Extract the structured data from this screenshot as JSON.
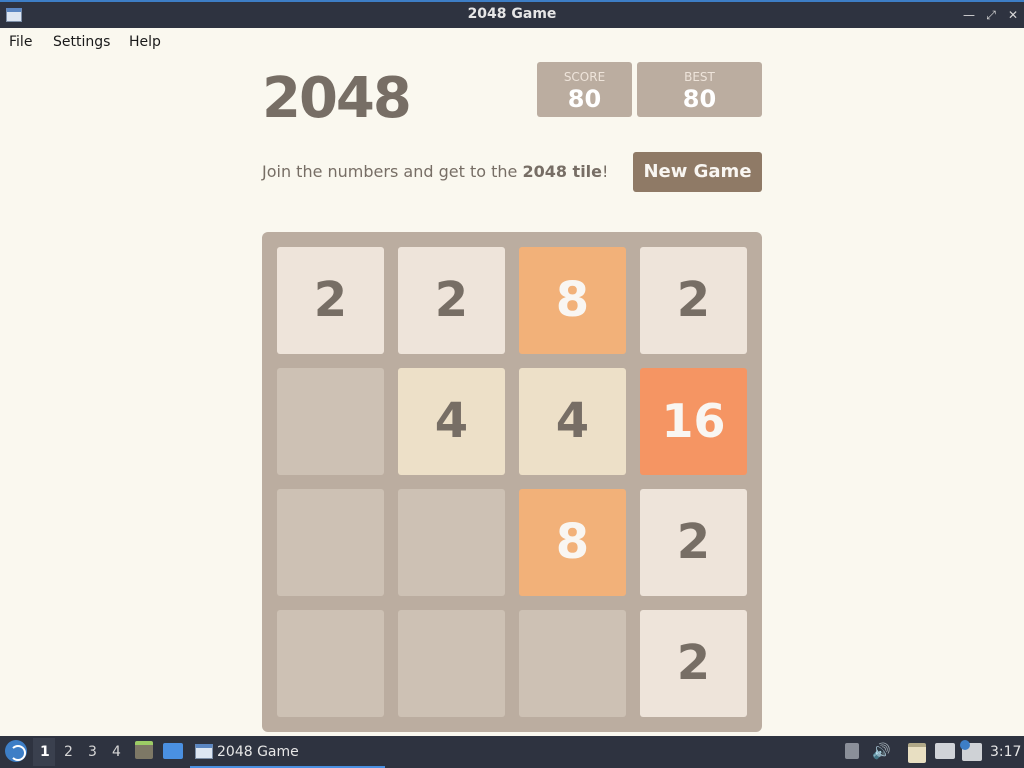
{
  "window": {
    "title": "2048 Game"
  },
  "menu": [
    "File",
    "Settings",
    "Help"
  ],
  "game": {
    "title": "2048",
    "score_label": "SCORE",
    "score": "80",
    "best_label": "BEST",
    "best": "80",
    "intro_prefix": "Join the numbers and get to the ",
    "intro_goal": "2048 tile",
    "intro_suffix": "!",
    "new_game_label": "New Game",
    "board": [
      [
        "2",
        "2",
        "8",
        "2"
      ],
      [
        "",
        "4",
        "4",
        "16"
      ],
      [
        "",
        "",
        "8",
        "2"
      ],
      [
        "",
        "",
        "",
        "2"
      ]
    ],
    "colors": {
      "background": "#faf8ef",
      "board": "#bbada0",
      "empty": "#cdc1b4",
      "tile_2": "#eee4da",
      "tile_4": "#ede0c8",
      "tile_8": "#f2b179",
      "tile_16": "#f59563",
      "button": "#8f7a66"
    }
  },
  "taskbar": {
    "workspaces": [
      "1",
      "2",
      "3",
      "4"
    ],
    "active_workspace": "1",
    "task_label": "2048 Game",
    "clock": "3:17"
  }
}
